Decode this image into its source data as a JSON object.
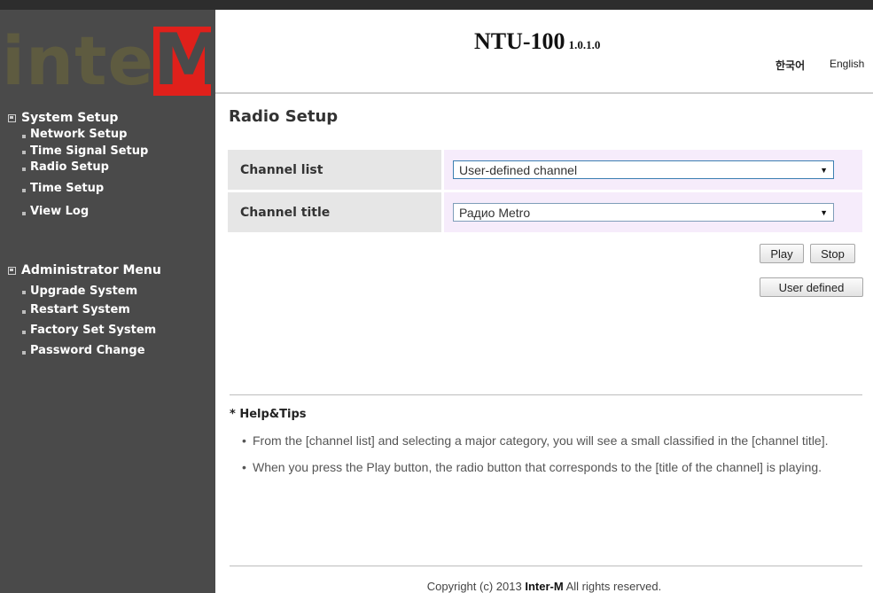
{
  "logo": {
    "text": "inter",
    "letter": "M"
  },
  "header": {
    "product": "NTU-100",
    "version": "1.0.1.0",
    "languages": [
      "한국어",
      "English"
    ]
  },
  "sidebar": {
    "sections": [
      {
        "title": "System Setup",
        "items": [
          "Network Setup",
          "Time Signal Setup",
          "Radio Setup",
          "Time Setup",
          "View Log"
        ]
      },
      {
        "title": "Administrator Menu",
        "items": [
          "Upgrade System",
          "Restart System",
          "Factory Set System",
          "Password Change"
        ]
      }
    ]
  },
  "main": {
    "page_title": "Radio Setup",
    "fields": [
      {
        "label": "Channel list",
        "value": "User-defined channel"
      },
      {
        "label": "Channel title",
        "value": "Радио Metro"
      }
    ],
    "buttons": {
      "play": "Play",
      "stop": "Stop",
      "user_defined": "User defined"
    }
  },
  "help": {
    "title": "* Help&Tips",
    "tips": [
      "From the [channel list] and selecting a major category, you will see a small classified in the [channel title].",
      "When you press the Play button, the radio button that corresponds to the [title of the channel] is playing."
    ]
  },
  "footer": {
    "prefix": "Copyright (c) 2013 ",
    "company": "Inter-M",
    "suffix": " All rights reserved."
  }
}
